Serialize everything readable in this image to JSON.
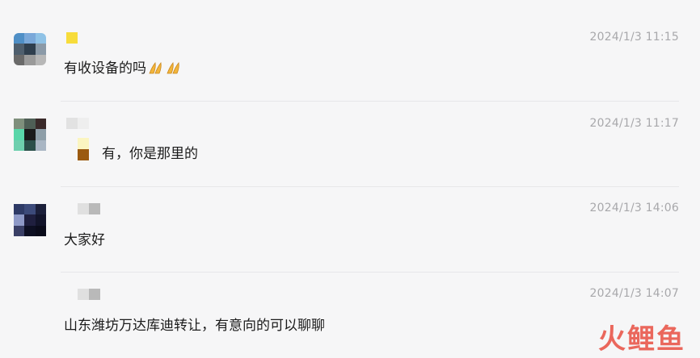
{
  "messages": [
    {
      "time": "2024/1/3 11:15",
      "text": "有收设备的吗",
      "emoji": "praying-hands",
      "avatar_colors": [
        "#4f8fc6",
        "#7aa8d9",
        "#8fc2e6",
        "#4f5f6e",
        "#2f3f4e",
        "#8b9aa8",
        "#6a6a6a",
        "#9a9a9a",
        "#b7b7b7"
      ],
      "name_colors": [
        "#f7dc3b"
      ]
    },
    {
      "time": "2024/1/3 11:17",
      "text": "有，你是那里的",
      "avatar_colors": [
        "#7f8f7c",
        "#4f5f56",
        "#3a2a2a",
        "#59d6a9",
        "#1a1a1a",
        "#8e9ea8",
        "#6ecfae",
        "#2b4f4a",
        "#a9b6c4"
      ],
      "name_colors": [
        "#e2e2e2",
        "#eeeeee"
      ],
      "quote_colors": [
        "#fbf5c0",
        "#9b5a10"
      ]
    },
    {
      "time": "2024/1/3 14:06",
      "text": "大家好",
      "avatar_colors": [
        "#2e3a66",
        "#3c4a7a",
        "#1b1f3a",
        "#8e99c7",
        "#1f1f3f",
        "#12142a",
        "#3a3f66",
        "#0d0f22",
        "#0a0b1a"
      ],
      "name_colors": [
        "#e0e0e0",
        "#b9b9b9"
      ]
    },
    {
      "time": "2024/1/3 14:07",
      "text": "山东潍坊万达库迪转让，有意向的可以聊聊",
      "name_colors": [
        "#e0e0e0",
        "#b9b9b9"
      ]
    }
  ],
  "watermark": "火鲤鱼"
}
